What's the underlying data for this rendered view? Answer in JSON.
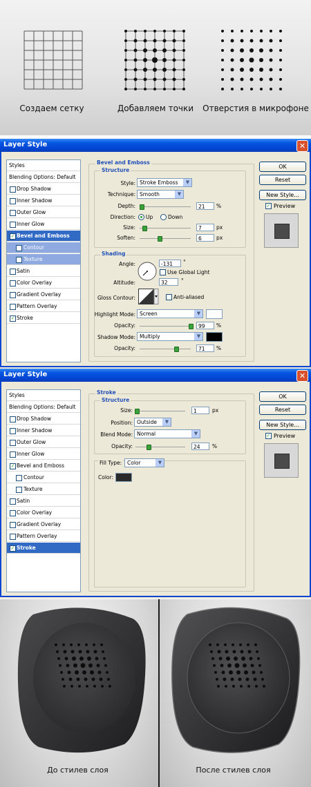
{
  "captions": {
    "grid": "Создаем сетку",
    "dots": "Добавляем точки",
    "holes": "Отверстия в микрофоне",
    "before": "До стилев слоя",
    "after": "После стилев слоя"
  },
  "dialog": {
    "title": "Layer Style",
    "close": "✕",
    "buttons": {
      "ok": "OK",
      "reset": "Reset",
      "new_style": "New Style...",
      "preview": "Preview"
    }
  },
  "sidebar": {
    "header": "Styles",
    "blending": "Blending Options: Default",
    "items": [
      "Drop Shadow",
      "Inner Shadow",
      "Outer Glow",
      "Inner Glow",
      "Bevel and Emboss",
      "Contour",
      "Texture",
      "Satin",
      "Color Overlay",
      "Gradient Overlay",
      "Pattern Overlay",
      "Stroke"
    ]
  },
  "bevel": {
    "section": "Bevel and Emboss",
    "structure": "Structure",
    "style_label": "Style:",
    "style_value": "Stroke Emboss",
    "technique_label": "Technique:",
    "technique_value": "Smooth",
    "depth_label": "Depth:",
    "depth_value": "21",
    "depth_unit": "%",
    "direction_label": "Direction:",
    "up": "Up",
    "down": "Down",
    "size_label": "Size:",
    "size_value": "7",
    "size_unit": "px",
    "soften_label": "Soften:",
    "soften_value": "6",
    "soften_unit": "px",
    "shading": "Shading",
    "angle_label": "Angle:",
    "angle_value": "-131",
    "angle_unit": "°",
    "global_light": "Use Global Light",
    "altitude_label": "Altitude:",
    "altitude_value": "32",
    "altitude_unit": "°",
    "gloss_label": "Gloss Contour:",
    "anti_aliased": "Anti-aliased",
    "highlight_label": "Highlight Mode:",
    "highlight_value": "Screen",
    "hl_opacity_label": "Opacity:",
    "hl_opacity_value": "99",
    "hl_opacity_unit": "%",
    "shadow_label": "Shadow Mode:",
    "shadow_value": "Multiply",
    "sh_opacity_label": "Opacity:",
    "sh_opacity_value": "71",
    "sh_opacity_unit": "%",
    "highlight_color": "#ffffff",
    "shadow_color": "#000000"
  },
  "stroke": {
    "section": "Stroke",
    "structure": "Structure",
    "size_label": "Size:",
    "size_value": "1",
    "size_unit": "px",
    "position_label": "Position:",
    "position_value": "Outside",
    "blend_label": "Blend Mode:",
    "blend_value": "Normal",
    "opacity_label": "Opacity:",
    "opacity_value": "24",
    "opacity_unit": "%",
    "fill_label": "Fill Type:",
    "fill_value": "Color",
    "color_label": "Color:",
    "color": "#2a2a2a"
  },
  "colors": {
    "titlebar": "#0246d6",
    "selected": "#316ac5",
    "dialog_bg": "#ece9d8"
  }
}
